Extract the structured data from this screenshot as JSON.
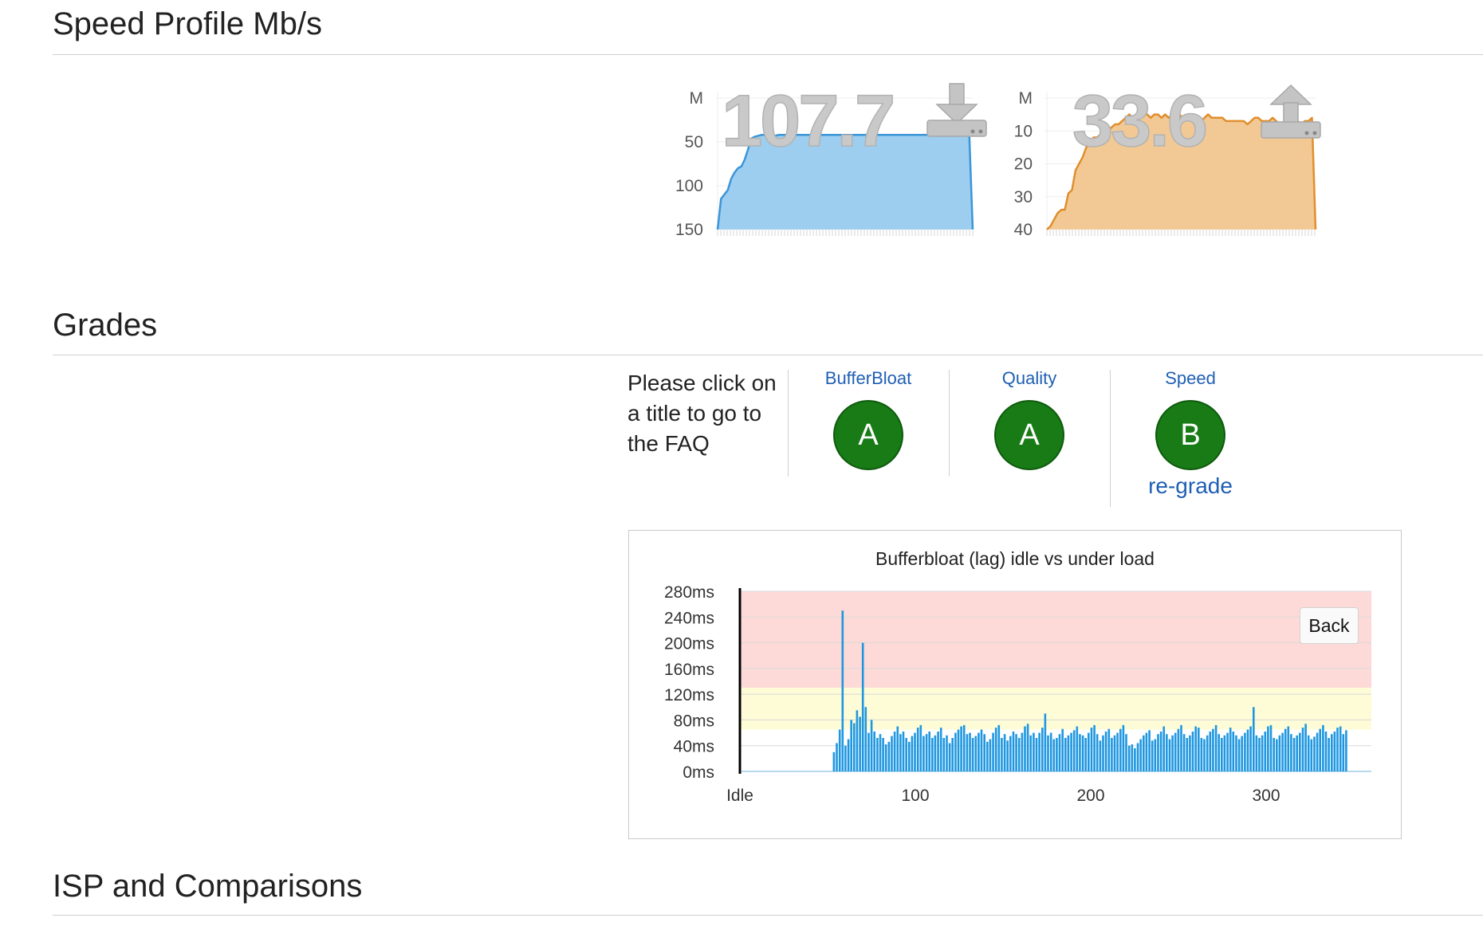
{
  "sections": {
    "speed_profile": "Speed Profile Mb/s",
    "grades": "Grades",
    "isp": "ISP and Comparisons"
  },
  "download": {
    "value": "107.7"
  },
  "upload": {
    "value": "33.6"
  },
  "grades": {
    "help_lines": [
      "Please click on",
      "a title to go to",
      "the FAQ"
    ],
    "items": [
      {
        "title": "BufferBloat",
        "grade": "A"
      },
      {
        "title": "Quality",
        "grade": "A"
      },
      {
        "title": "Speed",
        "grade": "B",
        "link": "re-grade"
      }
    ]
  },
  "bufferbloat": {
    "back_label": "Back"
  },
  "colors": {
    "download": "#3a96d8",
    "download_fill": "#9dcdef",
    "upload": "#e08e2d",
    "upload_fill": "#f2c995",
    "bars": "#1f97e0",
    "red_zone": "#fddad8",
    "yellow_zone": "#fdfcd6",
    "grade_green": "#187b16",
    "link": "#1f5fb4"
  },
  "chart_data": [
    {
      "type": "area",
      "series": [
        {
          "values": [
            0,
            35,
            40,
            45,
            58,
            65,
            70,
            72,
            80,
            92,
            104,
            106,
            107,
            108,
            108,
            108,
            108,
            107,
            108,
            108,
            108,
            107,
            108,
            108,
            108,
            108,
            108,
            108,
            108,
            108,
            108,
            108,
            108,
            108,
            108,
            108,
            108,
            108,
            108,
            108,
            108,
            108,
            108,
            108,
            108,
            108,
            108,
            108,
            108,
            108,
            108,
            108,
            108,
            108,
            108,
            108,
            108,
            108,
            108,
            108,
            108,
            108,
            108,
            108,
            108,
            108,
            108,
            108,
            108,
            108,
            108,
            108,
            108,
            107,
            108,
            0
          ]
        }
      ],
      "y_ticks": [
        "M",
        "50",
        "100",
        "150"
      ],
      "ylim": [
        0,
        150
      ]
    },
    {
      "type": "area",
      "series": [
        {
          "values": [
            0,
            1,
            3,
            5,
            6,
            6,
            11,
            12,
            18,
            20,
            22,
            25,
            26,
            28,
            28,
            29,
            29,
            30,
            31,
            32,
            32,
            33,
            34,
            35,
            34,
            35,
            34,
            35,
            35,
            34,
            35,
            35,
            34,
            35,
            34,
            35,
            35,
            35,
            34,
            34,
            35,
            34,
            34,
            33,
            34,
            35,
            34,
            34,
            34,
            34,
            33,
            33,
            33,
            33,
            33,
            33,
            32,
            33,
            34,
            34,
            33,
            33,
            33,
            34,
            33,
            32,
            32,
            32,
            33,
            33,
            33,
            32,
            33,
            33,
            34,
            0
          ]
        }
      ],
      "y_ticks": [
        "M",
        "10",
        "20",
        "30",
        "40"
      ],
      "ylim": [
        0,
        40
      ]
    },
    {
      "type": "bar",
      "title": "Bufferbloat (lag) idle vs under load",
      "y_ticks": [
        "0ms",
        "40ms",
        "80ms",
        "120ms",
        "160ms",
        "200ms",
        "240ms",
        "280ms"
      ],
      "ylim": [
        0,
        280
      ],
      "x_ticks": [
        "Idle",
        "100",
        "200",
        "300"
      ],
      "xlim": [
        0,
        360
      ],
      "zones": [
        {
          "name": "red",
          "from": 130,
          "to": 280
        },
        {
          "name": "yellow",
          "from": 65,
          "to": 130
        }
      ],
      "idle_end": 53,
      "values": [
        30,
        44,
        65,
        250,
        40,
        50,
        80,
        75,
        95,
        85,
        200,
        100,
        60,
        80,
        62,
        52,
        58,
        52,
        42,
        46,
        55,
        62,
        70,
        58,
        62,
        52,
        46,
        55,
        60,
        68,
        72,
        55,
        58,
        62,
        52,
        56,
        62,
        68,
        52,
        56,
        44,
        52,
        60,
        65,
        70,
        72,
        58,
        60,
        52,
        55,
        60,
        65,
        58,
        46,
        50,
        60,
        68,
        72,
        52,
        58,
        48,
        55,
        62,
        58,
        52,
        60,
        70,
        74,
        56,
        60,
        52,
        60,
        68,
        90,
        56,
        60,
        50,
        52,
        58,
        66,
        52,
        56,
        60,
        64,
        70,
        58,
        56,
        52,
        60,
        68,
        72,
        58,
        48,
        56,
        62,
        66,
        52,
        56,
        60,
        66,
        72,
        58,
        40,
        42,
        36,
        44,
        50,
        56,
        60,
        64,
        48,
        50,
        58,
        62,
        70,
        58,
        50,
        56,
        60,
        66,
        72,
        58,
        52,
        56,
        62,
        70,
        68,
        52,
        50,
        56,
        62,
        66,
        72,
        58,
        52,
        56,
        60,
        68,
        62,
        56,
        50,
        55,
        60,
        65,
        70,
        100,
        56,
        52,
        56,
        62,
        70,
        72,
        52,
        50,
        56,
        60,
        66,
        70,
        58,
        52,
        56,
        60,
        68,
        74,
        56,
        50,
        54,
        60,
        66,
        72,
        62,
        52,
        58,
        62,
        68,
        70,
        58,
        64
      ]
    }
  ]
}
